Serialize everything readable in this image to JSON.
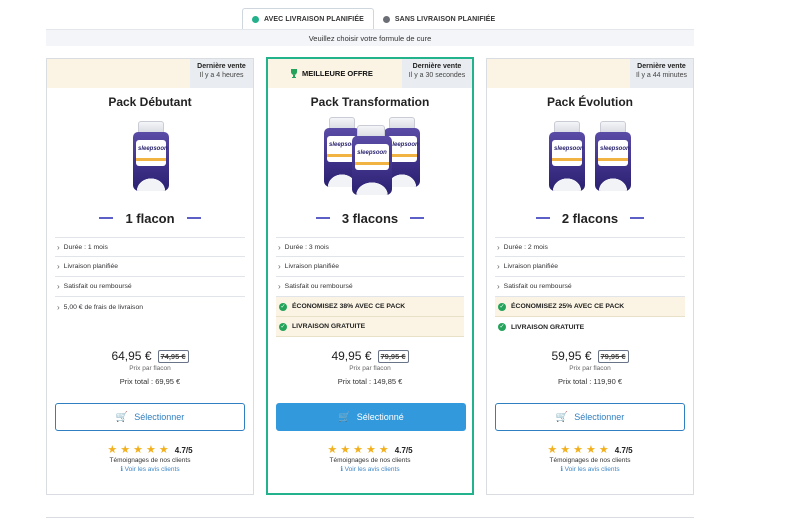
{
  "tabs": [
    {
      "label": "AVEC LIVRAISON PLANIFIÉE",
      "active": true
    },
    {
      "label": "SANS LIVRAISON PLANIFIÉE",
      "active": false
    }
  ],
  "subtitle": "Veuillez choisir votre formule de cure",
  "cards": [
    {
      "tag_title": "Dernière vente",
      "tag_time": "Il y a 4 heures",
      "title": "Pack Débutant",
      "brand": "sleepsoon",
      "quantity": "1 flacon",
      "features": [
        "Durée : 1 mois",
        "Livraison planifiée",
        "Satisfait ou remboursé",
        "5,00 € de frais de livraison"
      ],
      "price": "64,95 €",
      "old_price": "74,95 €",
      "per": "Prix par flacon",
      "total": "Prix total : 69,95 €",
      "button": "Sélectionner",
      "score": "4.7/5",
      "testimonials": "Témoignages de nos clients",
      "see_reviews": "Voir les avis clients"
    },
    {
      "best": "MEILLEURE OFFRE",
      "tag_title": "Dernière vente",
      "tag_time": "Il y a 30 secondes",
      "title": "Pack Transformation",
      "brand": "sleepsoon",
      "quantity": "3 flacons",
      "features": [
        "Durée : 3 mois",
        "Livraison planifiée",
        "Satisfait ou remboursé"
      ],
      "highlights": [
        "ÉCONOMISEZ 38% AVEC CE PACK",
        "LIVRAISON GRATUITE"
      ],
      "price": "49,95 €",
      "old_price": "79,95 €",
      "per": "Prix par flacon",
      "total": "Prix total : 149,85 €",
      "button": "Sélectionné",
      "score": "4.7/5",
      "testimonials": "Témoignages de nos clients",
      "see_reviews": "Voir les avis clients"
    },
    {
      "tag_title": "Dernière vente",
      "tag_time": "Il y a 44 minutes",
      "title": "Pack Évolution",
      "brand": "sleepsoon",
      "quantity": "2 flacons",
      "features": [
        "Durée : 2 mois",
        "Livraison planifiée",
        "Satisfait ou remboursé"
      ],
      "highlights": [
        "ÉCONOMISEZ 25% AVEC CE PACK",
        "LIVRAISON GRATUITE"
      ],
      "price": "59,95 €",
      "old_price": "79,95 €",
      "per": "Prix par flacon",
      "total": "Prix total : 119,90 €",
      "button": "Sélectionner",
      "score": "4.7/5",
      "testimonials": "Témoignages de nos clients",
      "see_reviews": "Voir les avis clients"
    }
  ],
  "rating_stars": 5,
  "colors": {
    "accent": "#22b38d",
    "button": "#3399dd",
    "star": "#f2b01e",
    "highlight_bg": "#fbf4e4"
  }
}
